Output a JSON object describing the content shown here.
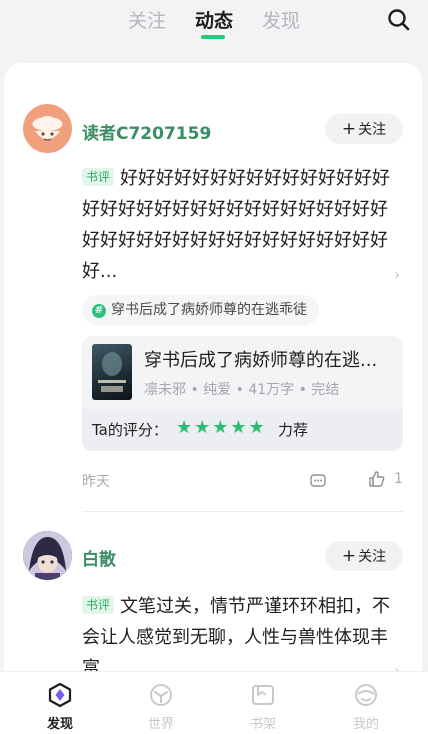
{
  "top_tabs": [
    "关注",
    "动态",
    "发现"
  ],
  "active_tab": "动态",
  "posts": [
    {
      "username": "读者C7207159",
      "follow_label": "关注",
      "tag": "书评",
      "review_text": "好好好好好好好好好好好好好好好好好好好好好好好好好好好好好好好好好好好好好好好好好好好好好好好好好好...",
      "topic": "穿书后成了病娇师尊的在逃乖徒",
      "book": {
        "title": "穿书后成了病娇师尊的在逃...",
        "meta": "凛未邪 • 纯爱 • 41万字 • 完结",
        "rating_label": "Ta的评分：",
        "stars": 5,
        "rating_word": "力荐"
      },
      "time": "昨天",
      "likes": "1"
    },
    {
      "username": "白散",
      "follow_label": "关注",
      "tag": "书评",
      "review_text": "文笔过关，情节严谨环环相扣，不会让人感觉到无聊，人性与兽性体现丰富"
    }
  ],
  "bottom_nav": [
    {
      "label": "发现",
      "icon": "discover-icon"
    },
    {
      "label": "世界",
      "icon": "world-icon"
    },
    {
      "label": "书架",
      "icon": "bookshelf-icon"
    },
    {
      "label": "我的",
      "icon": "profile-icon"
    }
  ],
  "accent_color": "#2cc97b"
}
